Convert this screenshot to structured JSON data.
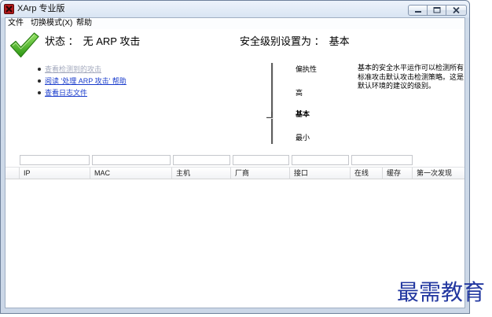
{
  "window": {
    "title": "XArp 专业版",
    "app_icon": "xarp-app-icon",
    "controls": [
      "minimize-icon",
      "maximize-icon",
      "close-icon"
    ]
  },
  "menu": {
    "items": [
      "文件",
      "切换模式(X)",
      "帮助"
    ]
  },
  "status": {
    "icon": "checkmark-icon",
    "label": "状态 ：",
    "value": "无 ARP 攻击"
  },
  "security": {
    "label": "安全级别设置为 ：",
    "value": "基本",
    "levels": [
      "偏执性",
      "高",
      "基本",
      "最小"
    ],
    "selected_index": 2,
    "description_lines": [
      "基本的安全水平运作可以检测所有",
      "标准攻击默认攻击检测策略。这是",
      "默认环境的建议的级别。"
    ]
  },
  "links": [
    {
      "label": "查看检测到的攻击",
      "enabled": false
    },
    {
      "label": "阅读 '处理 ARP 攻击' 帮助",
      "enabled": true
    },
    {
      "label": "查看日志文件",
      "enabled": true
    }
  ],
  "table": {
    "columns": [
      "IP",
      "MAC",
      "主机",
      "厂商",
      "接口",
      "在线",
      "缓存",
      "第一次发现"
    ],
    "filters": [
      "",
      "",
      "",
      "",
      "",
      ""
    ],
    "rows": []
  },
  "watermark": "最需教育",
  "colors": {
    "link": "#1a3ccc",
    "link_disabled": "#a3a9bd",
    "watermark": "#2338a0"
  }
}
